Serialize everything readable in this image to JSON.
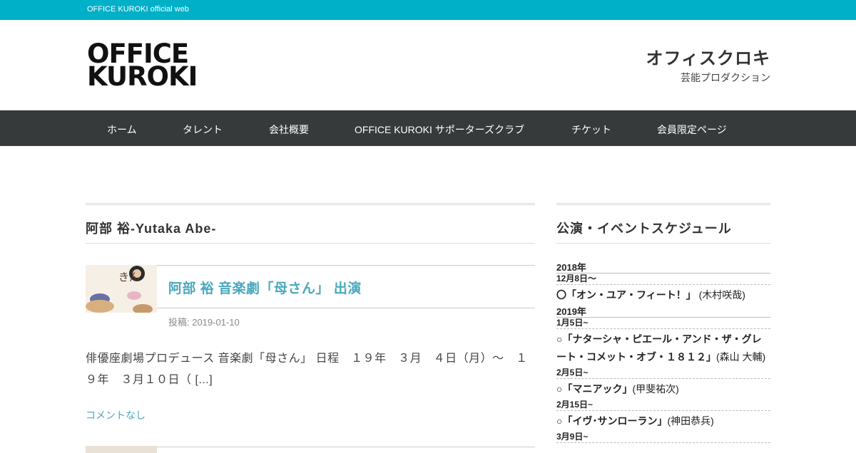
{
  "topbar": {
    "text": "OFFICE KUROKI official web"
  },
  "header": {
    "logo_line1": "OFFICE",
    "logo_line2": "KUROKI",
    "site_name": "オフィスクロキ",
    "site_subtitle": "芸能プロダクション"
  },
  "nav": {
    "items": [
      {
        "label": "ホーム"
      },
      {
        "label": "タレント"
      },
      {
        "label": "会社概要"
      },
      {
        "label": "OFFICE KUROKI サポーターズクラブ"
      },
      {
        "label": "チケット"
      },
      {
        "label": "会員限定ページ"
      }
    ]
  },
  "main": {
    "page_title": "阿部 裕-Yutaka Abe-",
    "post": {
      "thumb_text": "きん",
      "title": "阿部 裕 音楽劇「母さん」 出演",
      "meta": "投稿: 2019-01-10",
      "excerpt": "俳優座劇場プロデュース 音楽劇「母さん」 日程　１９年　３月　４日（月）～　１９年　３月１０日（ [...]",
      "comments": "コメントなし"
    }
  },
  "sidebar": {
    "title": "公演・イベントスケジュール",
    "sections": [
      {
        "year": "2018年",
        "entries": [
          {
            "date": "12月8日〜",
            "title": "〇「オン・ユア・フィート！」",
            "person": " (木村咲哉)"
          }
        ]
      },
      {
        "year": "2019年",
        "entries": [
          {
            "date": "1月5日~",
            "title": "○「ナターシャ・ピエール・アンド・ザ・グレート・コメット・オブ・１８１２」",
            "person": "(森山 大輔)"
          },
          {
            "date": "2月5日~",
            "title": "○「マニアック」",
            "person": "(甲斐祐次)"
          },
          {
            "date": "2月15日~",
            "title": "○「イヴ･サンローラン」",
            "person": "(神田恭兵)"
          },
          {
            "date": "3月9日~",
            "title": "",
            "person": ""
          }
        ]
      }
    ]
  },
  "colors": {
    "topbar": "#00b0c8",
    "nav_bg": "#363a3a",
    "link": "#4aa8bd"
  }
}
